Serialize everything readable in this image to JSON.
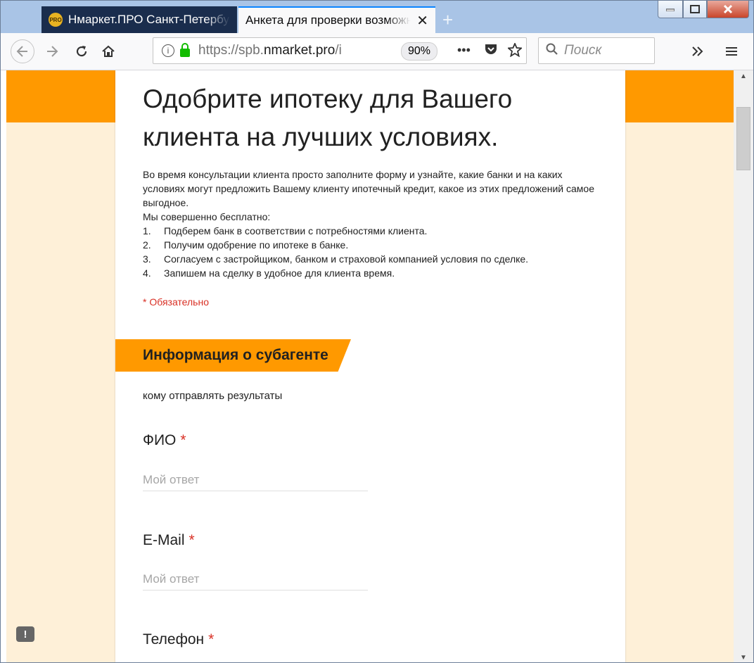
{
  "browser": {
    "tabs": [
      {
        "favicon": "PRO",
        "title": "Нмаркет.ПРО Санкт-Петербург"
      },
      {
        "title": "Анкета для проверки возможности",
        "close": "✕"
      }
    ],
    "new_tab": "+",
    "url_prefix": "https://spb.",
    "url_domain": "nmarket.pro",
    "url_suffix": "/i",
    "zoom": "90%",
    "search_placeholder": "Поиск",
    "icons": [
      "back-icon",
      "forward-icon",
      "reload-icon",
      "home-icon",
      "info-icon",
      "lock-icon",
      "more-icon",
      "pocket-icon",
      "bookmark-star-icon",
      "search-icon",
      "overflow-chevron-icon",
      "menu-icon"
    ]
  },
  "form": {
    "title": "Одобрите ипотеку для Вашего клиента на лучших условиях.",
    "intro_lines": [
      "Во время консультации клиента просто заполните форму и узнайте, какие банки и на каких условиях могут предложить Вашему клиенту ипотечный кредит, какое из этих предложений самое выгодное.",
      "Мы совершенно бесплатно:"
    ],
    "list": [
      {
        "n": "1.",
        "text": "Подберем банк в соответствии с потребностями клиента."
      },
      {
        "n": "2.",
        "text": "Получим одобрение по ипотеке в банке."
      },
      {
        "n": "3.",
        "text": "Согласуем с застройщиком, банком и страховой компанией условия по сделке."
      },
      {
        "n": "4.",
        "text": "Запишем на сделку в удобное для клиента время."
      }
    ],
    "required_note": "* Обязательно",
    "section_title": "Информация о субагенте",
    "section_description": "кому отправлять результаты",
    "questions": [
      {
        "label": "ФИО",
        "required": "*",
        "placeholder": "Мой ответ"
      },
      {
        "label": "E-Mail",
        "required": "*",
        "placeholder": "Мой ответ"
      },
      {
        "label": "Телефон",
        "required": "*"
      }
    ],
    "report_icon": "!"
  },
  "colors": {
    "accent": "#ff9900",
    "page_bg": "#fef0d8",
    "required": "#d93025"
  }
}
